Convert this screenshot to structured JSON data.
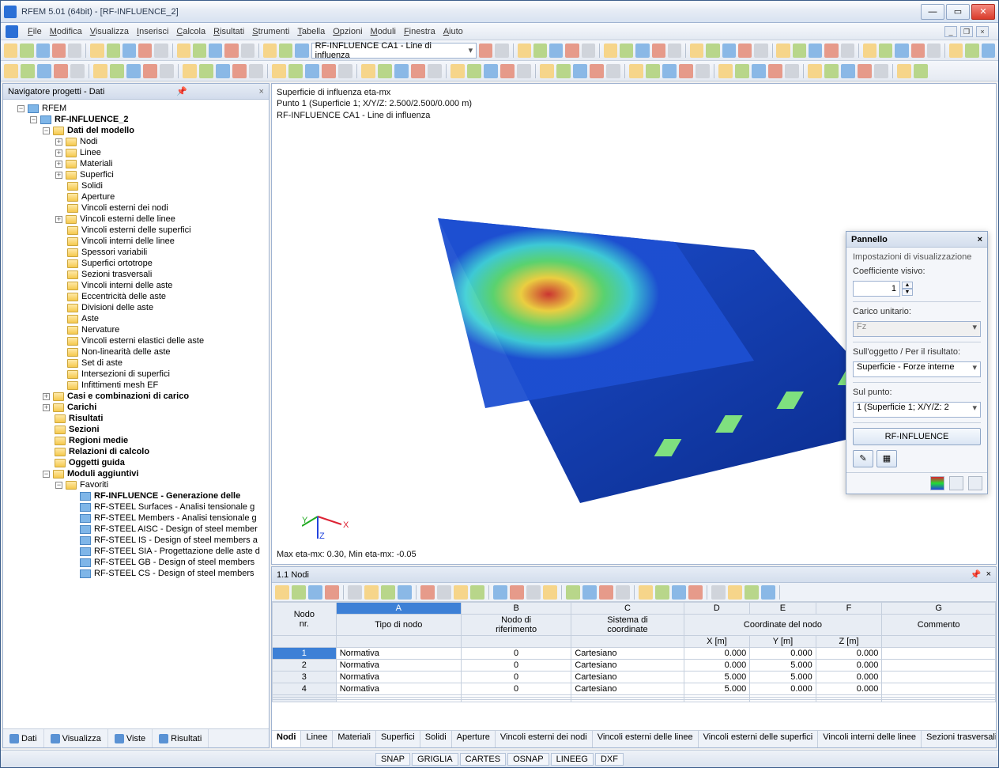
{
  "title": "RFEM 5.01 (64bit) - [RF-INFLUENCE_2]",
  "menu": [
    "File",
    "Modifica",
    "Visualizza",
    "Inserisci",
    "Calcola",
    "Risultati",
    "Strumenti",
    "Tabella",
    "Opzioni",
    "Moduli",
    "Finestra",
    "Aiuto"
  ],
  "toolbar_dropdown": "RF-INFLUENCE CA1 - Line di influenza",
  "nav_title": "Navigatore progetti - Dati",
  "tree_root": "RFEM",
  "tree_project": "RF-INFLUENCE_2",
  "tree_model_data": "Dati del modello",
  "model_items": [
    "Nodi",
    "Linee",
    "Materiali",
    "Superfici",
    "Solidi",
    "Aperture",
    "Vincoli esterni dei nodi",
    "Vincoli esterni delle linee",
    "Vincoli esterni delle superfici",
    "Vincoli interni delle linee",
    "Spessori variabili",
    "Superfici ortotrope",
    "Sezioni trasversali",
    "Vincoli interni delle aste",
    "Eccentricità delle aste",
    "Divisioni delle aste",
    "Aste",
    "Nervature",
    "Vincoli esterni elastici delle aste",
    "Non-linearità delle aste",
    "Set di aste",
    "Intersezioni di superfici",
    "Infittimenti mesh EF"
  ],
  "other_groups": [
    "Casi e combinazioni di carico",
    "Carichi",
    "Risultati",
    "Sezioni",
    "Regioni medie",
    "Relazioni di calcolo",
    "Oggetti guida"
  ],
  "addon_group": "Moduli aggiuntivi",
  "favorites": "Favoriti",
  "addons": [
    "RF-INFLUENCE - Generazione delle",
    "RF-STEEL Surfaces - Analisi tensionale g",
    "RF-STEEL Members - Analisi tensionale g",
    "RF-STEEL AISC - Design of steel member",
    "RF-STEEL IS - Design of steel members a",
    "RF-STEEL SIA - Progettazione delle aste d",
    "RF-STEEL GB - Design of steel members",
    "RF-STEEL CS - Design of steel members"
  ],
  "nav_tabs": [
    "Dati",
    "Visualizza",
    "Viste",
    "Risultati"
  ],
  "viewport": {
    "line1": "Superficie di influenza eta-mx",
    "line2": "Punto 1 (Superficie 1; X/Y/Z: 2.500/2.500/0.000 m)",
    "line3": "RF-INFLUENCE CA1 - Line di influenza",
    "maxmin": "Max eta-mx: 0.30, Min eta-mx: -0.05"
  },
  "panel": {
    "title": "Pannello",
    "section": "Impostazioni di visualizzazione",
    "coef_label": "Coefficiente visivo:",
    "coef_val": "1",
    "unit_label": "Carico unitario:",
    "unit_val": "Fz",
    "obj_label": "Sull'oggetto / Per il risultato:",
    "obj_val": "Superficie - Forze interne",
    "point_label": "Sul punto:",
    "point_val": "1 (Superficie 1; X/Y/Z: 2",
    "module_btn": "RF-INFLUENCE"
  },
  "table": {
    "title": "1.1 Nodi",
    "cols_top": [
      "A",
      "B",
      "C",
      "D",
      "E",
      "F",
      "G"
    ],
    "h_nodo": "Nodo\nnr.",
    "h_tipo": "Tipo di nodo",
    "h_rif": "Nodo di\nriferimento",
    "h_sist": "Sistema di\ncoordinate",
    "h_coord": "Coordinate del nodo",
    "h_x": "X [m]",
    "h_y": "Y [m]",
    "h_z": "Z [m]",
    "h_comm": "Commento",
    "rows": [
      {
        "n": "1",
        "tipo": "Normativa",
        "rif": "0",
        "sist": "Cartesiano",
        "x": "0.000",
        "y": "0.000",
        "z": "0.000"
      },
      {
        "n": "2",
        "tipo": "Normativa",
        "rif": "0",
        "sist": "Cartesiano",
        "x": "0.000",
        "y": "5.000",
        "z": "0.000"
      },
      {
        "n": "3",
        "tipo": "Normativa",
        "rif": "0",
        "sist": "Cartesiano",
        "x": "5.000",
        "y": "5.000",
        "z": "0.000"
      },
      {
        "n": "4",
        "tipo": "Normativa",
        "rif": "0",
        "sist": "Cartesiano",
        "x": "5.000",
        "y": "0.000",
        "z": "0.000"
      }
    ],
    "tabs": [
      "Nodi",
      "Linee",
      "Materiali",
      "Superfici",
      "Solidi",
      "Aperture",
      "Vincoli esterni dei nodi",
      "Vincoli esterni delle linee",
      "Vincoli esterni delle superfici",
      "Vincoli interni delle linee",
      "Sezioni trasversali"
    ]
  },
  "status": [
    "SNAP",
    "GRIGLIA",
    "CARTES",
    "OSNAP",
    "LINEEG",
    "DXF"
  ]
}
